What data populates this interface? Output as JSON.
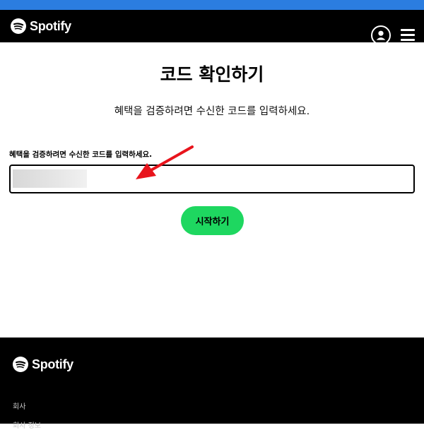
{
  "header": {
    "logo_text": "Spotify",
    "profile_icon": "user-icon",
    "menu_icon": "hamburger-menu-icon"
  },
  "main": {
    "title": "코드 확인하기",
    "subtitle": "혜택을 검증하려면 수신한 코드를 입력하세요.",
    "field_label": "혜택을 검증하려면 수신한 코드를 입력하세요.",
    "code_value": "",
    "start_label": "시작하기"
  },
  "footer": {
    "logo_text": "Spotify",
    "section_label": "회사",
    "link_partial": "회사 정보"
  },
  "colors": {
    "accent": "#1ed760",
    "header_bg": "#000000",
    "top_strip": "#2b7de0"
  }
}
